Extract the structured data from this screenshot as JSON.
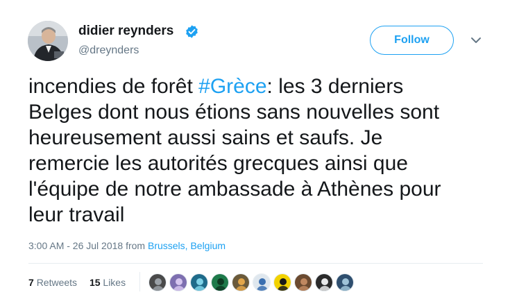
{
  "author": {
    "display_name": "didier reynders",
    "handle": "@dreynders",
    "verified": true,
    "avatar_icon": "profile-photo-icon"
  },
  "follow_button": {
    "label": "Follow"
  },
  "menu": {
    "icon": "chevron-down-icon"
  },
  "tweet": {
    "lines": [
      {
        "before": "incendies de forêt ",
        "hashtag": "#Grèce",
        "after": ": les 3 derniers"
      },
      {
        "text": "Belges dont nous étions sans nouvelles sont"
      },
      {
        "text": "heureusement aussi sains et saufs. Je"
      },
      {
        "text": "remercie les autorités grecques ainsi que"
      },
      {
        "text": "l'équipe de notre ambassade à Athènes pour"
      },
      {
        "text": "leur travail"
      }
    ]
  },
  "meta": {
    "timestamp": "3:00 AM - 26 Jul 2018",
    "from_label": "from",
    "location": "Brussels, Belgium"
  },
  "stats": {
    "retweets_count": "7",
    "retweets_label": "Retweets",
    "likes_count": "15",
    "likes_label": "Likes"
  },
  "likers": [
    {
      "icon": "liker-avatar-1",
      "color": "#4a4a4a",
      "accent": "#9aa0a6"
    },
    {
      "icon": "liker-avatar-2",
      "color": "#7e6fb0",
      "accent": "#d7c7f0"
    },
    {
      "icon": "liker-avatar-3",
      "color": "#1f6b8a",
      "accent": "#7fd3e8"
    },
    {
      "icon": "liker-avatar-4",
      "color": "#1e7a4a",
      "accent": "#0e3a22"
    },
    {
      "icon": "liker-avatar-5",
      "color": "#6b5a3a",
      "accent": "#e3a64a"
    },
    {
      "icon": "liker-avatar-6",
      "color": "#dfe7ee",
      "accent": "#3a6fb0"
    },
    {
      "icon": "liker-avatar-7",
      "color": "#f2d200",
      "accent": "#1a1a1a"
    },
    {
      "icon": "liker-avatar-8",
      "color": "#6b4a30",
      "accent": "#c08860"
    },
    {
      "icon": "liker-avatar-9",
      "color": "#2b2b2b",
      "accent": "#e9e9e9"
    },
    {
      "icon": "liker-avatar-10",
      "color": "#2f4f6f",
      "accent": "#9fc3d8"
    }
  ],
  "colors": {
    "link_blue": "#1da1f2",
    "text_primary": "#14171a",
    "text_secondary": "#657786",
    "divider": "#e6ecf0"
  }
}
